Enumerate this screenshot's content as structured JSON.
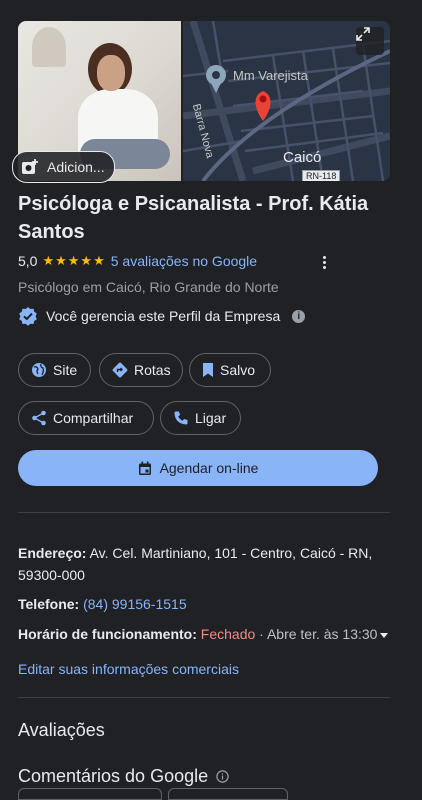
{
  "media": {
    "add_photo_label": "Adicion...",
    "map_labels": {
      "store": "Mm Varejista",
      "street": "Barra Nova",
      "city": "Caicó",
      "road": "RN-118"
    }
  },
  "business": {
    "name": "Psicóloga e Psicanalista - Prof. Kátia Santos",
    "rating": "5,0",
    "stars": "★★★★★",
    "reviews_link": "5 avaliações no Google",
    "category": "Psicólogo em Caicó, Rio Grande do Norte",
    "managed_text": "Você gerencia este Perfil da Empresa"
  },
  "actions": {
    "site": "Site",
    "routes": "Rotas",
    "saved": "Salvo",
    "share": "Compartilhar",
    "call": "Ligar",
    "book": "Agendar on-line"
  },
  "details": {
    "address_label": "Endereço:",
    "address_line1": "Av. Cel. Martiniano, 101 - Centro, Caicó - RN,",
    "address_line2": "59300-000",
    "phone_label": "Telefone:",
    "phone": "(84) 99156-1515",
    "hours_label": "Horário de funcionamento:",
    "hours_status": "Fechado",
    "hours_next": "· Abre ter. às 13:30",
    "edit_link": "Editar suas informações comerciais"
  },
  "reviews": {
    "heading": "Avaliações",
    "google_heading": "Comentários do Google"
  },
  "colors": {
    "accent": "#8ab4f8",
    "star": "#fbbc04",
    "closed": "#f28b82",
    "pin": "#ea4335"
  }
}
